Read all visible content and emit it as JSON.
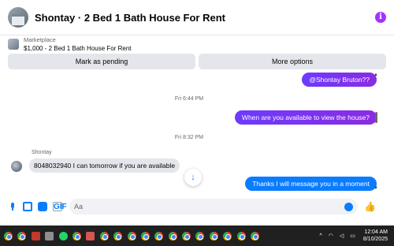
{
  "header": {
    "title": "Shontay · 2 Bed 1 Bath House For Rent",
    "avatar_icon": "house-photo-icon",
    "info_icon": "info-icon"
  },
  "listing": {
    "label": "Marketplace",
    "price_title": "$1,000 - 2 Bed 1 Bath House For Rent",
    "thumb_icon": "house-thumbnail-icon"
  },
  "actions": {
    "pending_label": "Mark as pending",
    "more_label": "More options"
  },
  "chat": {
    "messages_top": {
      "text": "@Shontay Bruton??"
    },
    "timestamp_1": "Fri 6:44 PM",
    "message_2": {
      "text": "When are you available to view the house?"
    },
    "timestamp_2": "Fri 8:32 PM",
    "sender_name": "Shontay",
    "message_3": {
      "text": "8048032940 I can tomorrow if you are available"
    },
    "message_4": {
      "text": "Thanks I will message you in a moment"
    },
    "scroll_down_icon": "arrow-down-icon",
    "scroll_up_glyph": "▲",
    "scroll_down_glyph": "▼"
  },
  "composer": {
    "placeholder": "Aa",
    "icons": [
      "microphone-icon",
      "photo-icon",
      "sticker-icon",
      "gif-icon",
      "emoji-icon",
      "thumbs-up-icon"
    ],
    "gif_label": "GIF"
  },
  "colors": {
    "accent_purple": "#8a2be2",
    "accent_blue": "#0a7cff",
    "taskbar_bg": "#202020"
  },
  "taskbar": {
    "time": "12:04 AM",
    "date": "8/10/2025",
    "tray_caret": "^",
    "tray_icons": [
      "chevron-up-icon",
      "wifi-icon",
      "volume-icon",
      "battery-icon"
    ]
  }
}
